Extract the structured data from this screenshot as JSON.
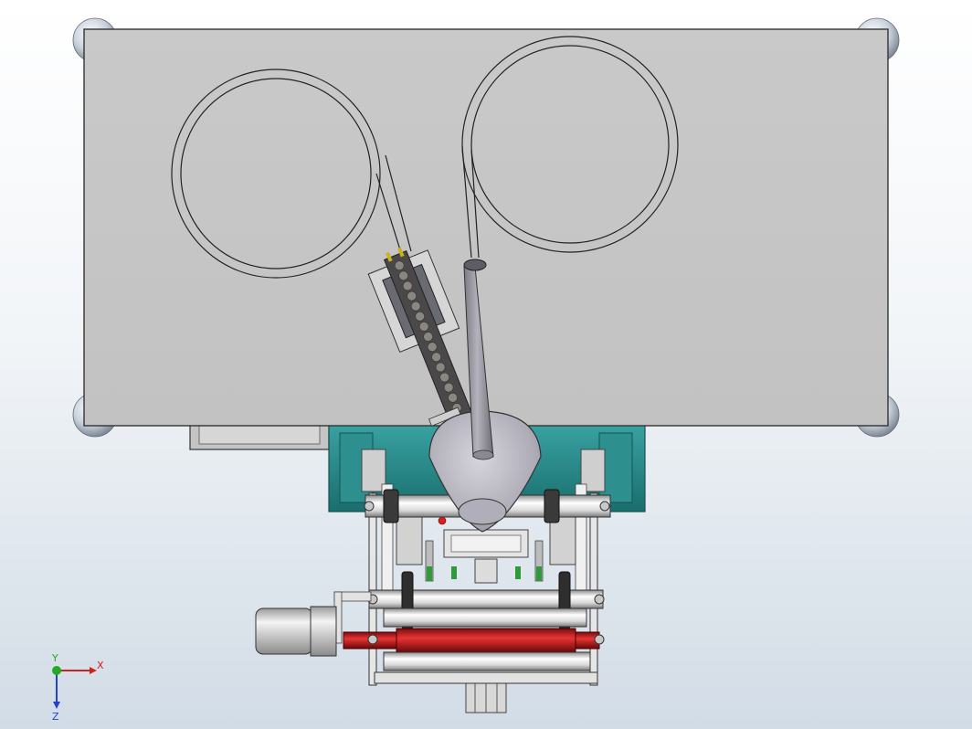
{
  "viewport": {
    "background_top": "#ffffff",
    "background_bottom": "#d2dce6"
  },
  "model": {
    "top_plate_color": "#c6c6c6",
    "base_frame_color": "#2a8a8a",
    "roller_color": "#e8e8e8",
    "drive_roller_color": "#c81c1c",
    "motor_color": "#d0d0d0",
    "indicator_color": "#2e9a3a"
  },
  "triad": {
    "x_label": "X",
    "y_label": "Y",
    "z_label": "Z",
    "x_color": "#cc2222",
    "y_color": "#22aa22",
    "z_color": "#2244cc"
  }
}
